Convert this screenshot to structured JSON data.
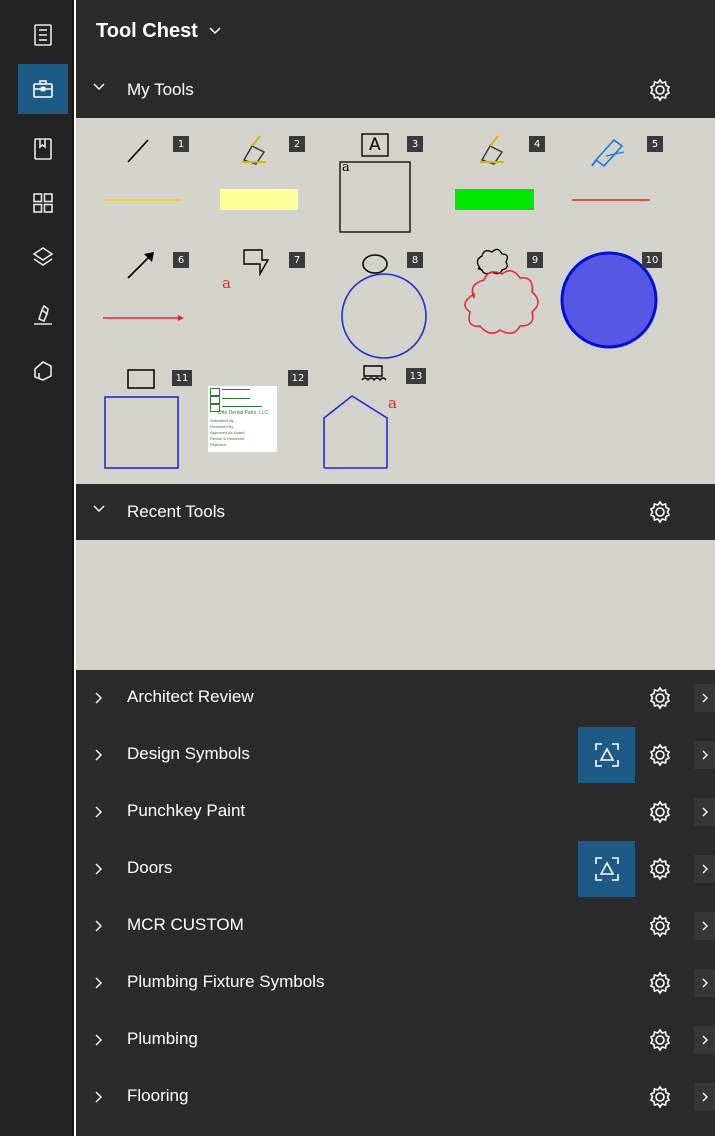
{
  "panel": {
    "title": "Tool Chest"
  },
  "rail": {
    "items": [
      {
        "icon": "properties-icon",
        "active": false
      },
      {
        "icon": "toolbox-icon",
        "active": true
      },
      {
        "icon": "bookmarks-icon",
        "active": false
      },
      {
        "icon": "thumbnails-icon",
        "active": false
      },
      {
        "icon": "layers-icon",
        "active": false
      },
      {
        "icon": "signature-icon",
        "active": false
      },
      {
        "icon": "spaces-icon",
        "active": false
      }
    ]
  },
  "sections": {
    "my_tools": {
      "label": "My Tools"
    },
    "recent_tools": {
      "label": "Recent Tools"
    }
  },
  "tools": [
    "1",
    "2",
    "3",
    "4",
    "5",
    "6",
    "7",
    "8",
    "9",
    "10",
    "11",
    "12",
    "13"
  ],
  "tool_labels": {
    "text_box": "A",
    "letter_a": "a"
  },
  "stamp": {
    "title": "Otto Dental Parts, LLC",
    "lines": [
      "Submitted By",
      "Reviewed By",
      "Approved As Noted",
      "Revise & Resubmit",
      "Rejected"
    ]
  },
  "categories": [
    {
      "label": "Architect Review",
      "capture": false
    },
    {
      "label": "Design Symbols",
      "capture": true
    },
    {
      "label": "Punchkey Paint",
      "capture": false
    },
    {
      "label": "Doors",
      "capture": true
    },
    {
      "label": "MCR CUSTOM",
      "capture": false
    },
    {
      "label": "Plumbing Fixture Symbols",
      "capture": false
    },
    {
      "label": "Plumbing",
      "capture": false
    },
    {
      "label": "Flooring",
      "capture": false
    }
  ],
  "colors": {
    "accent": "#1d5a86",
    "panel_bg": "#2b2b2b",
    "tool_area_bg": "#d4d3cb",
    "highlighter_yellow": "#ffff99",
    "highlighter_green": "#00e600",
    "markup_red": "#e8262b",
    "markup_blue": "#1f2fd6",
    "circle_fill": "#5757e6"
  }
}
